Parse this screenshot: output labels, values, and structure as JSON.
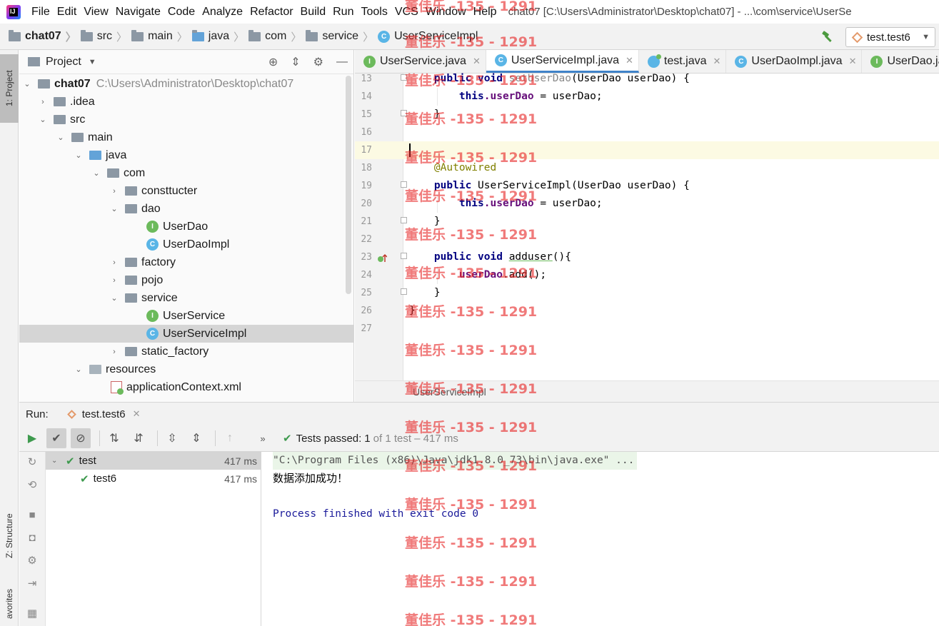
{
  "menu": {
    "items": [
      "File",
      "Edit",
      "View",
      "Navigate",
      "Code",
      "Analyze",
      "Refactor",
      "Build",
      "Run",
      "Tools",
      "VCS",
      "Window",
      "Help"
    ],
    "window_title": "chat07 [C:\\Users\\Administrator\\Desktop\\chat07] - ...\\com\\service\\UserSe"
  },
  "breadcrumb": [
    "chat07",
    "src",
    "main",
    "java",
    "com",
    "service",
    "UserServiceImpl"
  ],
  "run_config": "test.test6",
  "left_strip": {
    "project_tab": "1: Project",
    "structure_tab": "Z: Structure",
    "favorites_tab": "avorites"
  },
  "project_panel": {
    "title": "Project",
    "tree": [
      {
        "label": "chat07",
        "path": "C:\\Users\\Administrator\\Desktop\\chat07"
      },
      {
        "label": ".idea"
      },
      {
        "label": "src"
      },
      {
        "label": "main"
      },
      {
        "label": "java"
      },
      {
        "label": "com"
      },
      {
        "label": "consttucter"
      },
      {
        "label": "dao"
      },
      {
        "label": "UserDao"
      },
      {
        "label": "UserDaoImpl"
      },
      {
        "label": "factory"
      },
      {
        "label": "pojo"
      },
      {
        "label": "service"
      },
      {
        "label": "UserService"
      },
      {
        "label": "UserServiceImpl"
      },
      {
        "label": "static_factory"
      },
      {
        "label": "resources"
      },
      {
        "label": "applicationContext.xml"
      }
    ]
  },
  "editor": {
    "tabs": [
      {
        "label": "UserService.java"
      },
      {
        "label": "UserServiceImpl.java"
      },
      {
        "label": "test.java"
      },
      {
        "label": "UserDaoImpl.java"
      },
      {
        "label": "UserDao.java"
      }
    ],
    "line_numbers": [
      "13",
      "14",
      "15",
      "16",
      "17",
      "18",
      "19",
      "20",
      "21",
      "22",
      "23",
      "24",
      "25",
      "26",
      "27"
    ],
    "code": {
      "l13_kw": "public void",
      "l13_name": " setUserDao",
      "l13_rest": "(UserDao userDao) {",
      "l14_this": "this",
      "l14_field": ".userDao",
      "l14_rest": " = userDao;",
      "l15": "}",
      "l18": "@Autowired",
      "l19_kw": "public",
      "l19_rest": " UserServiceImpl(UserDao userDao) {",
      "l20_this": "this",
      "l20_field": ".userDao",
      "l20_rest": " = userDao;",
      "l21": "}",
      "l23_kw": "public void",
      "l23_name": "adduser",
      "l23_rest": "(){",
      "l24_field": "userDao",
      "l24_rest": ".add();",
      "l25": "}",
      "l26": "}"
    },
    "crumb": "UserServiceImpl"
  },
  "run_panel": {
    "label": "Run:",
    "tab": "test.test6",
    "status": {
      "prefix": "Tests passed:",
      "count": "1",
      "suffix": "of 1 test – 417 ms"
    },
    "tree": [
      {
        "label": "test",
        "time": "417 ms"
      },
      {
        "label": "test6",
        "time": "417 ms"
      }
    ],
    "console": {
      "cmd": "\"C:\\Program Files (x86)\\Java\\jdk1.8.0_73\\bin\\java.exe\" ...",
      "output": "数据添加成功！",
      "exit": "Process finished with exit code 0"
    }
  },
  "watermark": "董佳乐 -135 - 1291",
  "colors": {
    "accent": "#4083c9",
    "pass_green": "#3e9a4e",
    "keyword": "#000080",
    "field": "#660e7a",
    "annotation": "#808000",
    "watermark": "#e62828"
  }
}
